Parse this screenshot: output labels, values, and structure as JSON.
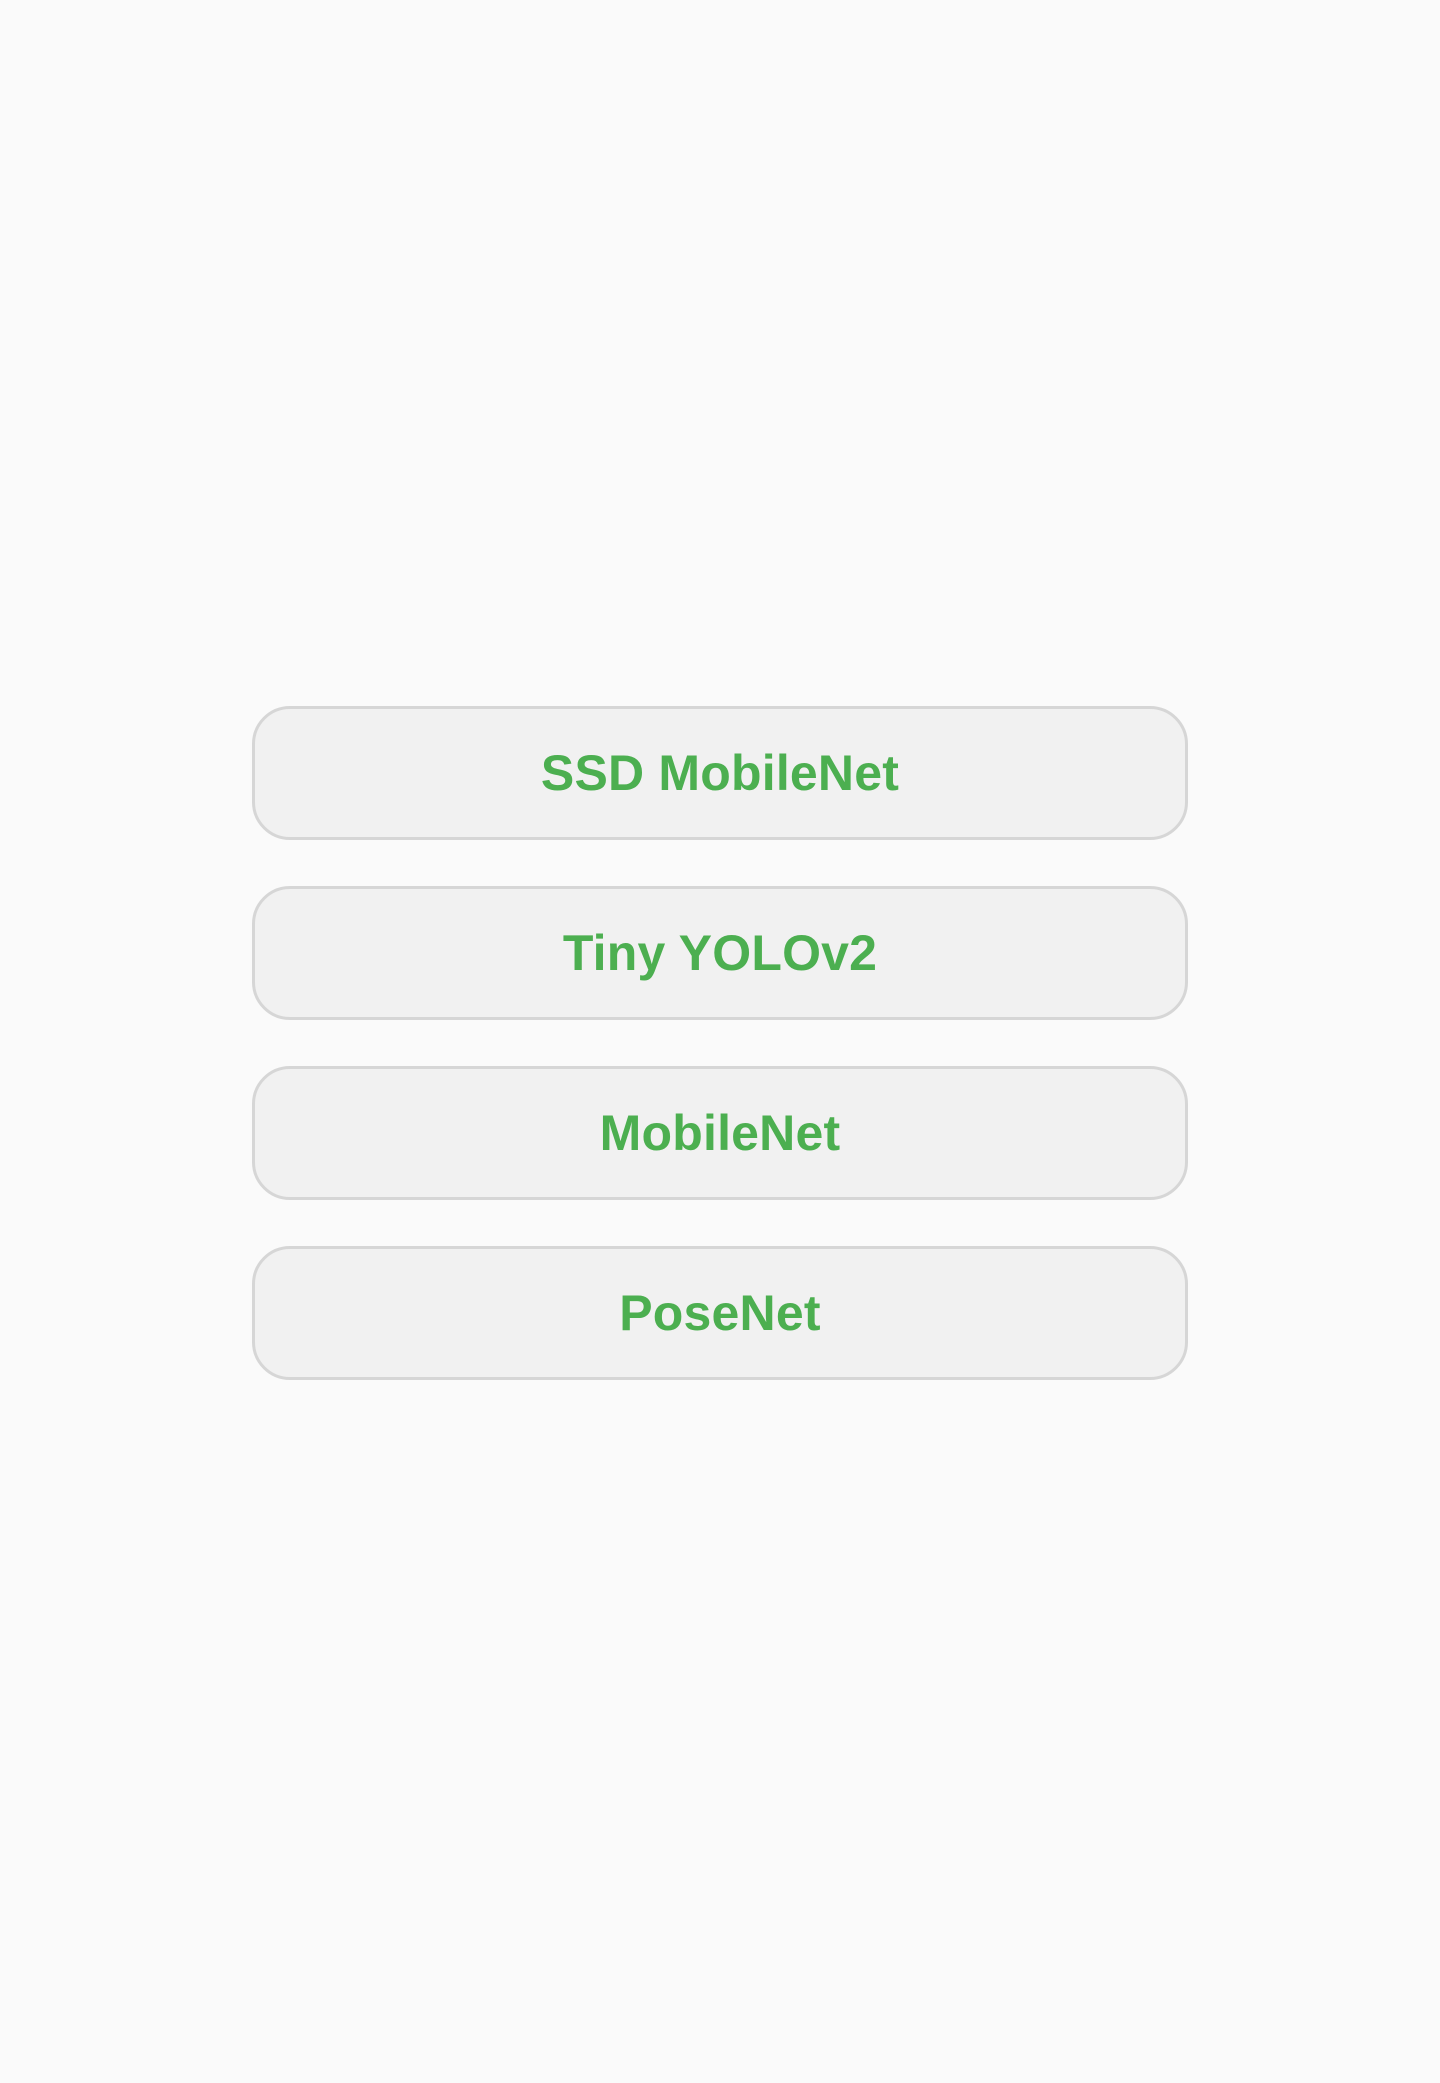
{
  "colors": {
    "background": "#fafafa",
    "button_fill": "#f1f1f1",
    "button_border": "#d6d6d6",
    "label_accent": "#4caf50"
  },
  "menu": {
    "buttons": [
      {
        "label": "SSD MobileNet"
      },
      {
        "label": "Tiny YOLOv2"
      },
      {
        "label": "MobileNet"
      },
      {
        "label": "PoseNet"
      }
    ]
  }
}
